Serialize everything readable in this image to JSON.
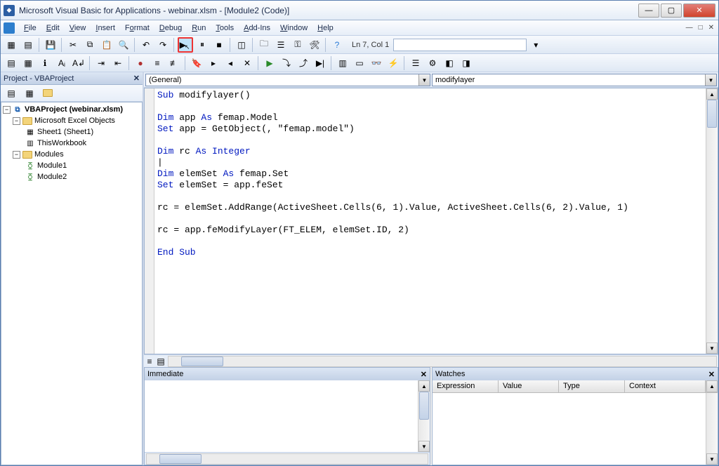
{
  "window": {
    "title": "Microsoft Visual Basic for Applications - webinar.xlsm - [Module2 (Code)]"
  },
  "menu": {
    "file": "File",
    "edit": "Edit",
    "view": "View",
    "insert": "Insert",
    "format": "Format",
    "debug": "Debug",
    "run": "Run",
    "tools": "Tools",
    "addins": "Add-Ins",
    "window": "Window",
    "help": "Help"
  },
  "toolbar": {
    "position": "Ln 7, Col 1"
  },
  "project_pane": {
    "title": "Project - VBAProject",
    "root": "VBAProject (webinar.xlsm)",
    "excel_objects": "Microsoft Excel Objects",
    "sheet1": "Sheet1 (Sheet1)",
    "thisworkbook": "ThisWorkbook",
    "modules": "Modules",
    "module1": "Module1",
    "module2": "Module2"
  },
  "code_header": {
    "left": "(General)",
    "right": "modifylayer"
  },
  "code": {
    "l1a": "Sub",
    "l1b": " modifylayer()",
    "l2": "",
    "l3a": "Dim",
    "l3b": " app ",
    "l3c": "As",
    "l3d": " femap.Model",
    "l4a": "Set",
    "l4b": " app = GetObject(, \"femap.model\")",
    "l5": "",
    "l6a": "Dim",
    "l6b": " rc ",
    "l6c": "As Integer",
    "l7": "",
    "l8a": "Dim",
    "l8b": " elemSet ",
    "l8c": "As",
    "l8d": " femap.Set",
    "l9a": "Set",
    "l9b": " elemSet = app.feSet",
    "l10": "",
    "l11": "rc = elemSet.AddRange(ActiveSheet.Cells(6, 1).Value, ActiveSheet.Cells(6, 2).Value, 1)",
    "l12": "",
    "l13": "rc = app.feModifyLayer(FT_ELEM, elemSet.ID, 2)",
    "l14": "",
    "l15a": "End Sub"
  },
  "immediate": {
    "title": "Immediate"
  },
  "watches": {
    "title": "Watches",
    "cols": {
      "expression": "Expression",
      "value": "Value",
      "type": "Type",
      "context": "Context"
    }
  }
}
